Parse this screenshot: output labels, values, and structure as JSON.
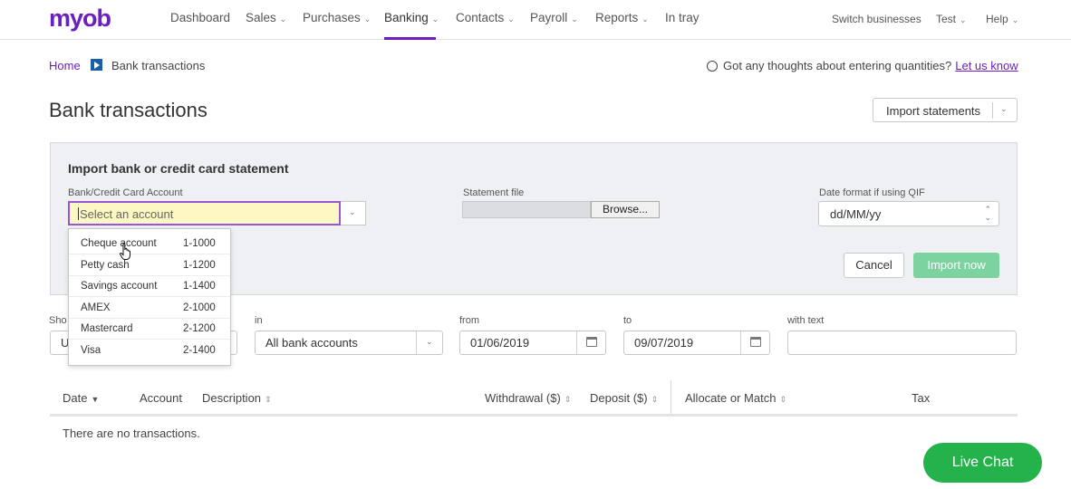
{
  "brand": {
    "logo": "myob",
    "accent": "#6b1fc1"
  },
  "nav": {
    "items": [
      {
        "label": "Dashboard",
        "has_menu": false
      },
      {
        "label": "Sales",
        "has_menu": true
      },
      {
        "label": "Purchases",
        "has_menu": true
      },
      {
        "label": "Banking",
        "has_menu": true,
        "active": true
      },
      {
        "label": "Contacts",
        "has_menu": true
      },
      {
        "label": "Payroll",
        "has_menu": true
      },
      {
        "label": "Reports",
        "has_menu": true
      },
      {
        "label": "In tray",
        "has_menu": false
      }
    ],
    "right": {
      "switch": "Switch businesses",
      "user": "Test",
      "help": "Help"
    }
  },
  "breadcrumb": {
    "home": "Home",
    "current": "Bank transactions"
  },
  "feedback": {
    "text": "Got any thoughts about entering quantities?",
    "link": "Let us know"
  },
  "page": {
    "title": "Bank transactions",
    "import_button": "Import statements"
  },
  "import_panel": {
    "title": "Import bank or credit card statement",
    "account_label": "Bank/Credit Card Account",
    "account_placeholder": "Select an account",
    "file_label": "Statement file",
    "browse": "Browse...",
    "date_format_label": "Date format if using QIF",
    "date_format_value": "dd/MM/yy",
    "cancel": "Cancel",
    "import_now": "Import now"
  },
  "account_options": [
    {
      "name": "Cheque account",
      "code": "1-1000"
    },
    {
      "name": "Petty cash",
      "code": "1-1200"
    },
    {
      "name": "Savings account",
      "code": "1-1400"
    },
    {
      "name": "AMEX",
      "code": "2-1000"
    },
    {
      "name": "Mastercard",
      "code": "2-1200"
    },
    {
      "name": "Visa",
      "code": "2-1400"
    }
  ],
  "filters": {
    "show_label": "Sho",
    "show_value": "U",
    "in_label": "in",
    "in_value": "All bank accounts",
    "from_label": "from",
    "from_value": "01/06/2019",
    "to_label": "to",
    "to_value": "09/07/2019",
    "text_label": "with text",
    "text_value": ""
  },
  "table": {
    "columns": {
      "date": "Date",
      "account": "Account",
      "description": "Description",
      "withdrawal": "Withdrawal ($)",
      "deposit": "Deposit ($)",
      "allocate": "Allocate or Match",
      "tax": "Tax"
    },
    "empty": "There are no transactions."
  },
  "live_chat": "Live Chat"
}
